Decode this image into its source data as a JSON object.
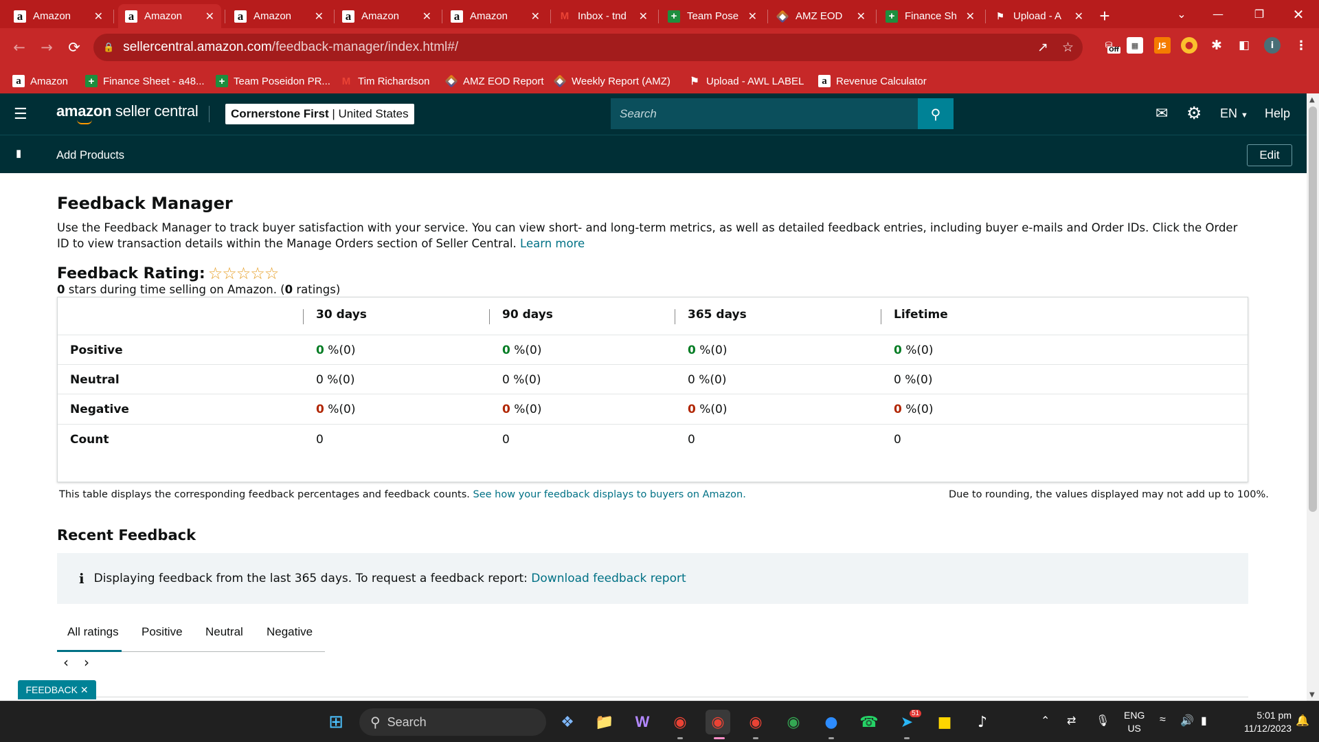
{
  "browser": {
    "tabs": [
      {
        "label": "Amazon",
        "icon": "amazon-icon",
        "active": false
      },
      {
        "label": "Amazon",
        "icon": "amazon-icon",
        "active": true
      },
      {
        "label": "Amazon",
        "icon": "amazon-icon",
        "active": false
      },
      {
        "label": "Amazon",
        "icon": "amazon-icon",
        "active": false
      },
      {
        "label": "Amazon",
        "icon": "amazon-icon",
        "active": false
      },
      {
        "label": "Inbox - tnd",
        "icon": "gmail-icon",
        "active": false
      },
      {
        "label": "Team Pose",
        "icon": "sheets-icon",
        "active": false
      },
      {
        "label": "AMZ EOD",
        "icon": "cube-icon",
        "active": false
      },
      {
        "label": "Finance Sh",
        "icon": "sheets-icon",
        "active": false
      },
      {
        "label": "Upload - A",
        "icon": "flag-icon",
        "active": false
      }
    ],
    "url_host": "sellercentral.amazon.com",
    "url_path": "/feedback-manager/index.html#/",
    "extension_off_badge": "Off",
    "profile_letter": "i",
    "bookmarks": [
      {
        "label": "Amazon",
        "icon": "amazon-icon"
      },
      {
        "label": "Finance Sheet - a48...",
        "icon": "sheets-icon"
      },
      {
        "label": "Team Poseidon PR...",
        "icon": "sheets-icon"
      },
      {
        "label": "Tim Richardson",
        "icon": "gmail-icon"
      },
      {
        "label": "AMZ EOD Report",
        "icon": "cube-icon"
      },
      {
        "label": "Weekly Report (AMZ)",
        "icon": "cube-icon"
      },
      {
        "label": "Upload - AWL LABEL",
        "icon": "flag-icon"
      },
      {
        "label": "Revenue Calculator",
        "icon": "amazon-icon"
      }
    ]
  },
  "header": {
    "logo_bold": "amazon",
    "logo_rest": " seller central",
    "store_name": "Cornerstone First",
    "store_sep": " | ",
    "store_region": "United States",
    "search_placeholder": "Search",
    "language": "EN",
    "help": "Help",
    "sub_nav_item": "Add Products",
    "edit": "Edit"
  },
  "page": {
    "title": "Feedback Manager",
    "intro": "Use the Feedback Manager to track buyer satisfaction with your service. You can view short- and long-term metrics, as well as detailed feedback entries, including buyer e-mails and Order IDs. Click the Order ID to view transaction details within the Manage Orders section of Seller Central.",
    "learn_more": "Learn more",
    "rating_title": "Feedback Rating:",
    "stars_filled": 0,
    "stars_total": 5,
    "rating_stars_value": "0",
    "rating_sub_mid": " stars during time selling on Amazon. (",
    "rating_count": "0",
    "rating_sub_end": " ratings)",
    "columns": [
      "30 days",
      "90 days",
      "365 days",
      "Lifetime"
    ],
    "rows": [
      {
        "label": "Positive",
        "kind": "pos",
        "values": [
          {
            "n": "0",
            "t": " %(0)"
          },
          {
            "n": "0",
            "t": " %(0)"
          },
          {
            "n": "0",
            "t": " %(0)"
          },
          {
            "n": "0",
            "t": " %(0)"
          }
        ]
      },
      {
        "label": "Neutral",
        "kind": "neu",
        "values": [
          {
            "n": "0",
            "t": " %(0)"
          },
          {
            "n": "0",
            "t": " %(0)"
          },
          {
            "n": "0",
            "t": " %(0)"
          },
          {
            "n": "0",
            "t": " %(0)"
          }
        ]
      },
      {
        "label": "Negative",
        "kind": "neg",
        "values": [
          {
            "n": "0",
            "t": " %(0)"
          },
          {
            "n": "0",
            "t": " %(0)"
          },
          {
            "n": "0",
            "t": " %(0)"
          },
          {
            "n": "0",
            "t": " %(0)"
          }
        ]
      },
      {
        "label": "Count",
        "kind": "count",
        "values": [
          {
            "n": "0",
            "t": ""
          },
          {
            "n": "0",
            "t": ""
          },
          {
            "n": "0",
            "t": ""
          },
          {
            "n": "0",
            "t": ""
          }
        ]
      }
    ],
    "footnote_left": "This table displays the corresponding feedback percentages and feedback counts.",
    "footnote_link": "See how your feedback displays to buyers on Amazon.",
    "footnote_right": "Due to rounding, the values displayed may not add up to 100%.",
    "recent_title": "Recent Feedback",
    "info_text": "Displaying feedback from the last 365 days. To request a feedback report:",
    "info_link": "Download feedback report",
    "rating_tabs": [
      "All ratings",
      "Positive",
      "Neutral",
      "Negative"
    ],
    "feedback_button": "FEEDBACK"
  },
  "taskbar": {
    "search_label": "Search",
    "language": "ENG",
    "region": "US",
    "time": "5:01 pm",
    "date": "11/12/2023",
    "telegram_badge": "51"
  },
  "colors": {
    "browser_frame": "#c62828",
    "sc_header": "#002f36",
    "link": "#007185",
    "positive": "#067d25",
    "negative": "#b12704",
    "star": "#e6a02a"
  }
}
